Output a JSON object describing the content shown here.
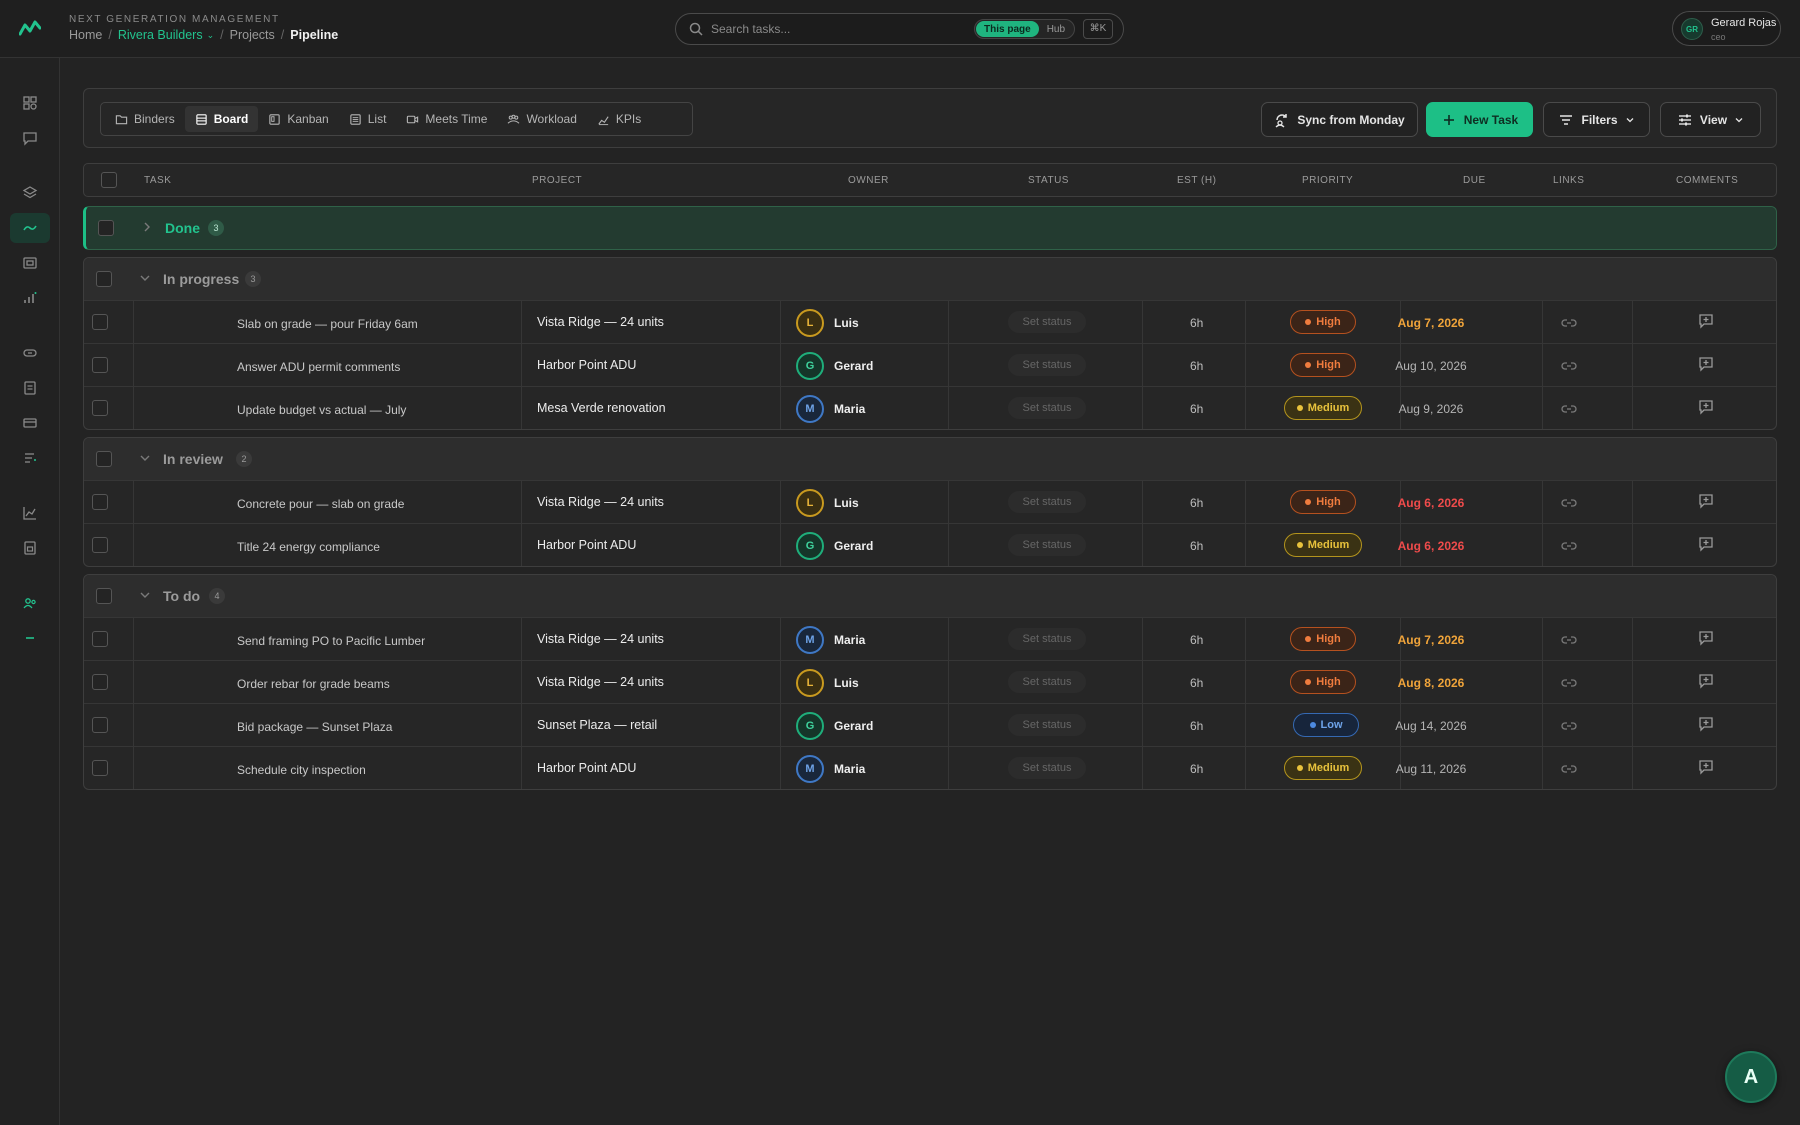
{
  "app": {
    "brand": "NEXT GENERATION MANAGEMENT",
    "breadcrumb": {
      "home": "Home",
      "workspace": "Rivera Builders",
      "section": "Projects",
      "current": "Pipeline"
    }
  },
  "search": {
    "placeholder": "Search tasks...",
    "scope_this_page": "This page",
    "scope_hub": "Hub",
    "shortcut": "⌘K"
  },
  "user": {
    "name": "Gerard Rojas",
    "role": "ceo",
    "initials": "GR"
  },
  "toolbar": {
    "tabs": [
      "Binders",
      "Board",
      "Kanban",
      "List",
      "Meets Time",
      "Workload",
      "KPIs"
    ],
    "active_tab": "Board",
    "sync_label": "Sync from Monday",
    "new_task_label": "New Task",
    "filters_label": "Filters",
    "view_label": "View"
  },
  "columns": [
    "TASK",
    "PROJECT",
    "OWNER",
    "STATUS",
    "EST (H)",
    "PRIORITY",
    "DUE",
    "LINKS",
    "COMMENTS"
  ],
  "groups": [
    {
      "name": "Done",
      "count": "3",
      "collapsed": true,
      "rows": []
    },
    {
      "name": "In progress",
      "count": "3",
      "collapsed": false,
      "rows": [
        {
          "task": "Slab on grade — pour Friday 6am",
          "project": "Vista Ridge — 24 units",
          "owner_initial": "L",
          "owner": "Luis",
          "status": "Set status",
          "est": "6h",
          "priority": "High",
          "due": "Aug 7, 2026",
          "due_state": "soon"
        },
        {
          "task": "Answer ADU permit comments",
          "project": "Harbor Point ADU",
          "owner_initial": "G",
          "owner": "Gerard",
          "status": "Set status",
          "est": "6h",
          "priority": "High",
          "due": "Aug 10, 2026",
          "due_state": "normal"
        },
        {
          "task": "Update budget vs actual — July",
          "project": "Mesa Verde renovation",
          "owner_initial": "M",
          "owner": "Maria",
          "status": "Set status",
          "est": "6h",
          "priority": "Medium",
          "due": "Aug 9, 2026",
          "due_state": "normal"
        }
      ]
    },
    {
      "name": "In review",
      "count": "2",
      "collapsed": false,
      "rows": [
        {
          "task": "Concrete pour — slab on grade",
          "project": "Vista Ridge — 24 units",
          "owner_initial": "L",
          "owner": "Luis",
          "status": "Set status",
          "est": "6h",
          "priority": "High",
          "due": "Aug 6, 2026",
          "due_state": "overdue"
        },
        {
          "task": "Title 24 energy compliance",
          "project": "Harbor Point ADU",
          "owner_initial": "G",
          "owner": "Gerard",
          "status": "Set status",
          "est": "6h",
          "priority": "Medium",
          "due": "Aug 6, 2026",
          "due_state": "overdue"
        }
      ]
    },
    {
      "name": "To do",
      "count": "4",
      "collapsed": false,
      "rows": [
        {
          "task": "Send framing PO to Pacific Lumber",
          "project": "Vista Ridge — 24 units",
          "owner_initial": "M",
          "owner": "Maria",
          "status": "Set status",
          "est": "6h",
          "priority": "High",
          "due": "Aug 7, 2026",
          "due_state": "soon"
        },
        {
          "task": "Order rebar for grade beams",
          "project": "Vista Ridge — 24 units",
          "owner_initial": "L",
          "owner": "Luis",
          "status": "Set status",
          "est": "6h",
          "priority": "High",
          "due": "Aug 8, 2026",
          "due_state": "soon"
        },
        {
          "task": "Bid package — Sunset Plaza",
          "project": "Sunset Plaza — retail",
          "owner_initial": "G",
          "owner": "Gerard",
          "status": "Set status",
          "est": "6h",
          "priority": "Low",
          "due": "Aug 14, 2026",
          "due_state": "normal"
        },
        {
          "task": "Schedule city inspection",
          "project": "Harbor Point ADU",
          "owner_initial": "M",
          "owner": "Maria",
          "status": "Set status",
          "est": "6h",
          "priority": "Medium",
          "due": "Aug 11, 2026",
          "due_state": "normal"
        }
      ]
    }
  ],
  "fab_label": "A",
  "colors": {
    "accent": "#1dbf86",
    "high": "#f07c3e",
    "medium": "#e8c23c",
    "low": "#6ea3e8",
    "overdue": "#ef4b4b",
    "soon": "#f0a43a"
  }
}
